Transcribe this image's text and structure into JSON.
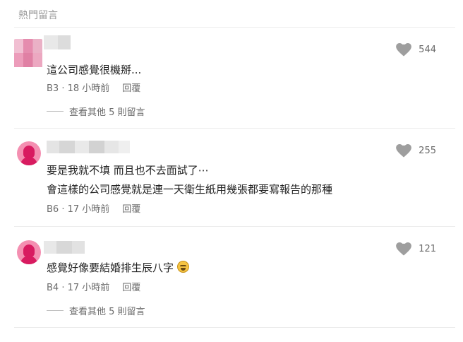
{
  "section": {
    "title": "熱門留言"
  },
  "comments": [
    {
      "lines": [
        "這公司感覺很機掰..."
      ],
      "floor": "B3",
      "time": "18 小時前",
      "reply_label": "回覆",
      "likes": "544",
      "more_replies": "查看其他 5 則留言"
    },
    {
      "lines": [
        "要是我就不填 而且也不去面試了⋯",
        "會這樣的公司感覺就是連一天衛生紙用幾張都要寫報告的那種"
      ],
      "floor": "B6",
      "time": "17 小時前",
      "reply_label": "回覆",
      "likes": "255"
    },
    {
      "lines": [
        "感覺好像要結婚排生辰八字"
      ],
      "floor": "B4",
      "time": "17 小時前",
      "reply_label": "回覆",
      "likes": "121",
      "more_replies": "查看其他 5 則留言"
    }
  ],
  "icons": {
    "like": "heart-icon",
    "emoji": "grinning-sweat-emoji"
  },
  "colors": {
    "heart": "#9e9e9e",
    "avatar_pink": "#f48fb1",
    "avatar_dark": "#d81b60"
  }
}
